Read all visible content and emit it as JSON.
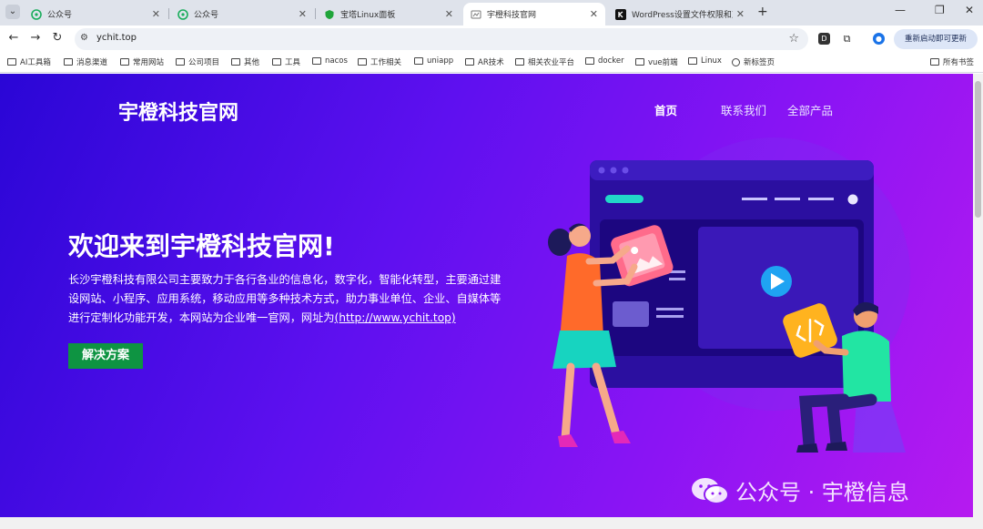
{
  "tabs": [
    {
      "title": "公众号",
      "active": false
    },
    {
      "title": "公众号",
      "active": false
    },
    {
      "title": "宝塔Linux面板",
      "active": false
    },
    {
      "title": "宇橙科技官网",
      "active": true
    },
    {
      "title": "WordPress设置文件权限和直接",
      "active": false
    }
  ],
  "address": {
    "url": "ychit.top"
  },
  "toolbar": {
    "ext_d": "D",
    "restart_label": "重新启动即可更新"
  },
  "bookmarks": [
    {
      "label": "AI工具箱"
    },
    {
      "label": "消息渠道"
    },
    {
      "label": "常用网站"
    },
    {
      "label": "公司项目"
    },
    {
      "label": "其他"
    },
    {
      "label": "工具"
    },
    {
      "label": "nacos"
    },
    {
      "label": "工作相关"
    },
    {
      "label": "uniapp"
    },
    {
      "label": "AR技术"
    },
    {
      "label": "相关农业平台"
    },
    {
      "label": "docker"
    },
    {
      "label": "vue前端"
    },
    {
      "label": "Linux"
    },
    {
      "label": "新标签页"
    },
    {
      "label": "所有书签"
    }
  ],
  "site": {
    "logo": "宇橙科技官网",
    "nav": [
      "首页",
      "联系我们",
      "全部产品"
    ],
    "hero_title": "欢迎来到宇橙科技官网!",
    "hero_desc_1": "长沙宇橙科技有限公司主要致力于各行各业的信息化，数字化，智能化转型，主要通过建设网站、小程序、应用系统，移动应用等多种技术方式，助力事业单位、企业、自媒体等进行定制化功能开发，本网站为企业唯一官网，网址为",
    "hero_desc_link": "(http://www.ychit.top)",
    "cta": "解决方案"
  },
  "watermark": {
    "text": "公众号 · 宇橙信息"
  },
  "colors": {
    "cta": "#0e9442",
    "accent": "#5f10f0"
  }
}
